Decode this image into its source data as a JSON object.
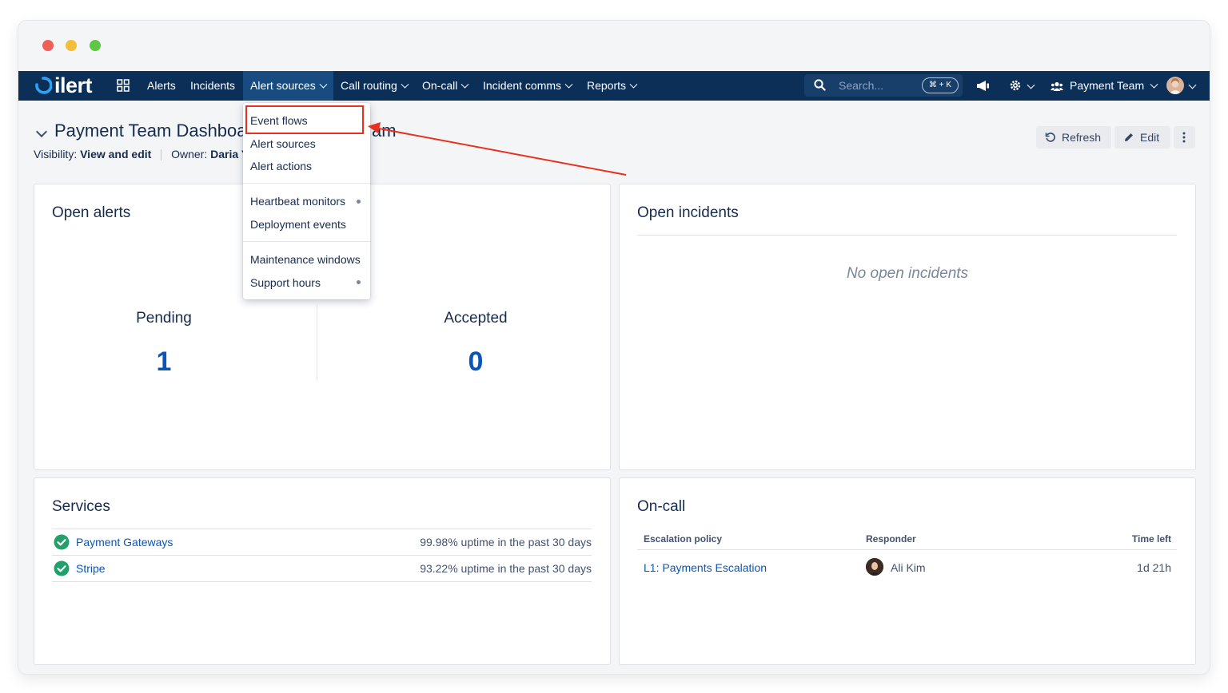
{
  "nav": {
    "logo_text": "ilert",
    "items": [
      {
        "label": "Alerts"
      },
      {
        "label": "Incidents"
      },
      {
        "label": "Alert sources"
      },
      {
        "label": "Call routing"
      },
      {
        "label": "On-call"
      },
      {
        "label": "Incident comms"
      },
      {
        "label": "Reports"
      }
    ],
    "search_placeholder": "Search...",
    "search_shortcut": "⌘ + K",
    "team_label": "Payment Team"
  },
  "page": {
    "title": "Payment Team Dashboa",
    "title_tail": "am",
    "visibility_label": "Visibility:",
    "visibility_value": "View and edit",
    "owner_label": "Owner:",
    "owner_value": "Daria Ya",
    "refresh_label": "Refresh",
    "edit_label": "Edit"
  },
  "dropdown": {
    "items": [
      {
        "label": "Event flows"
      },
      {
        "label": "Alert sources"
      },
      {
        "label": "Alert actions"
      },
      {
        "label": "Heartbeat monitors"
      },
      {
        "label": "Deployment events"
      },
      {
        "label": "Maintenance windows"
      },
      {
        "label": "Support hours"
      }
    ]
  },
  "open_alerts": {
    "title": "Open alerts",
    "pending_label": "Pending",
    "pending_value": "1",
    "accepted_label": "Accepted",
    "accepted_value": "0"
  },
  "open_incidents": {
    "title": "Open incidents",
    "empty_text": "No open incidents"
  },
  "services": {
    "title": "Services",
    "rows": [
      {
        "name": "Payment Gateways",
        "uptime": "99.98% uptime in the past 30 days"
      },
      {
        "name": "Stripe",
        "uptime": "93.22% uptime in the past 30 days"
      }
    ]
  },
  "oncall": {
    "title": "On-call",
    "headers": {
      "policy": "Escalation policy",
      "responder": "Responder",
      "time_left": "Time left"
    },
    "rows": [
      {
        "policy": "L1: Payments Escalation",
        "responder": "Ali Kim",
        "time_left": "1d 21h"
      }
    ]
  },
  "colors": {
    "nav_bg": "#0b2f56",
    "nav_active_bg": "#184b80",
    "link": "#0b55b6",
    "success": "#22a06b",
    "highlight": "#e8301f"
  }
}
